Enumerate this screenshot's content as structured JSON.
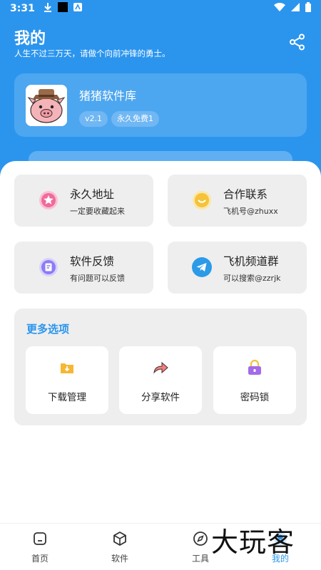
{
  "status_bar": {
    "time": "3:31"
  },
  "header": {
    "title": "我的",
    "subtitle": "人生不过三万天，请做个向前冲锋的勇士。"
  },
  "app_card": {
    "name": "猪猪软件库",
    "version": "v2.1",
    "tag": "永久免费1"
  },
  "tiles": [
    {
      "title": "永久地址",
      "subtitle": "一定要收藏起来",
      "icon": "star-icon",
      "color": "#f06b9a"
    },
    {
      "title": "合作联系",
      "subtitle": "飞机号@zhuxx",
      "icon": "smile-icon",
      "color": "#f5c23a"
    },
    {
      "title": "软件反馈",
      "subtitle": "有问题可以反馈",
      "icon": "feedback-icon",
      "color": "#8b7cf6"
    },
    {
      "title": "飞机频道群",
      "subtitle": "可以搜索@zzrjk",
      "icon": "telegram-icon",
      "color": "#2b9be8"
    }
  ],
  "more": {
    "title": "更多选项",
    "options": [
      {
        "label": "下载管理",
        "icon": "download-folder-icon",
        "color": "#f7b733"
      },
      {
        "label": "分享软件",
        "icon": "share-arrow-icon",
        "color": "#f07f7f"
      },
      {
        "label": "密码锁",
        "icon": "lock-icon",
        "color": "#a36be8"
      }
    ]
  },
  "nav": {
    "items": [
      {
        "label": "首页",
        "icon": "home-icon"
      },
      {
        "label": "软件",
        "icon": "box-icon"
      },
      {
        "label": "工具",
        "icon": "compass-icon"
      },
      {
        "label": "我的",
        "icon": "user-icon"
      }
    ],
    "active_index": 3
  },
  "colors": {
    "primary": "#2b95ee",
    "tile_bg": "#eeeeee"
  },
  "watermark": "大玩客"
}
